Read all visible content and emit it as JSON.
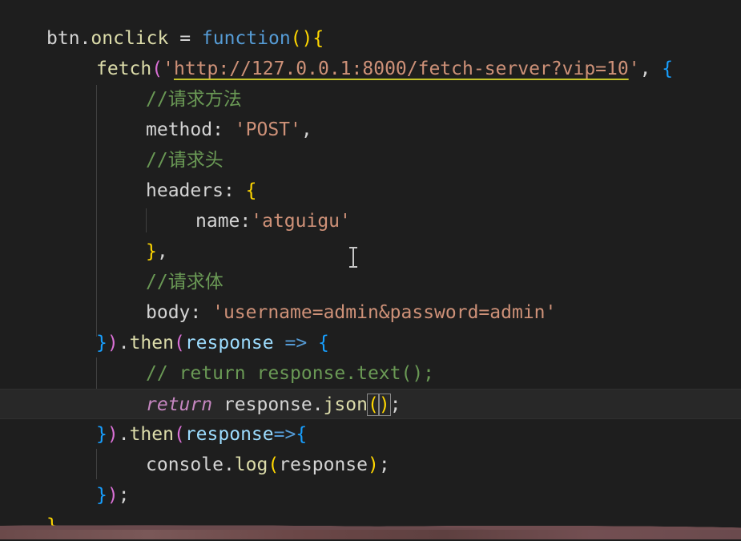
{
  "editor": {
    "lines": [
      {
        "tokens": [
          {
            "t": "btn",
            "c": "white"
          },
          {
            "t": ".",
            "c": "white"
          },
          {
            "t": "onclick",
            "c": "fn"
          },
          {
            "t": " = ",
            "c": "white"
          },
          {
            "t": "function",
            "c": "blue"
          },
          {
            "t": "(){",
            "c": "bracket-y"
          }
        ]
      },
      {
        "tokens": [
          {
            "t": "fetch",
            "c": "fn"
          },
          {
            "t": "(",
            "c": "bracket-p"
          },
          {
            "t": "'",
            "c": "str"
          },
          {
            "t": "http://127.0.0.1:8000/fetch-server?vip=10",
            "c": "url"
          },
          {
            "t": "'",
            "c": "str"
          },
          {
            "t": ", ",
            "c": "white"
          },
          {
            "t": "{",
            "c": "bracket-b"
          }
        ]
      },
      {
        "tokens": [
          {
            "t": "//请求方法",
            "c": "cmt"
          }
        ]
      },
      {
        "tokens": [
          {
            "t": "method",
            "c": "white"
          },
          {
            "t": ": ",
            "c": "white"
          },
          {
            "t": "'POST'",
            "c": "str"
          },
          {
            "t": ",",
            "c": "white"
          }
        ]
      },
      {
        "tokens": [
          {
            "t": "//请求头",
            "c": "cmt"
          }
        ]
      },
      {
        "tokens": [
          {
            "t": "headers",
            "c": "white"
          },
          {
            "t": ": ",
            "c": "white"
          },
          {
            "t": "{",
            "c": "bracket-y"
          }
        ]
      },
      {
        "tokens": [
          {
            "t": "name",
            "c": "white"
          },
          {
            "t": ":",
            "c": "white"
          },
          {
            "t": "'atguigu'",
            "c": "str"
          }
        ]
      },
      {
        "tokens": [
          {
            "t": "}",
            "c": "bracket-y"
          },
          {
            "t": ",",
            "c": "white"
          }
        ]
      },
      {
        "tokens": [
          {
            "t": "//请求体",
            "c": "cmt"
          }
        ]
      },
      {
        "tokens": [
          {
            "t": "body",
            "c": "white"
          },
          {
            "t": ": ",
            "c": "white"
          },
          {
            "t": "'username=admin&password=admin'",
            "c": "str"
          }
        ]
      },
      {
        "tokens": [
          {
            "t": "}",
            "c": "bracket-b"
          },
          {
            "t": ")",
            "c": "bracket-p"
          },
          {
            "t": ".",
            "c": "white"
          },
          {
            "t": "then",
            "c": "fn"
          },
          {
            "t": "(",
            "c": "bracket-p"
          },
          {
            "t": "response",
            "c": "param"
          },
          {
            "t": " ",
            "c": "white"
          },
          {
            "t": "=>",
            "c": "blue"
          },
          {
            "t": " ",
            "c": "white"
          },
          {
            "t": "{",
            "c": "bracket-b"
          }
        ]
      },
      {
        "tokens": [
          {
            "t": "// return response.text();",
            "c": "cmt"
          }
        ]
      },
      {
        "tokens": [
          {
            "t": "return",
            "c": "kw it"
          },
          {
            "t": " response",
            "c": "white"
          },
          {
            "t": ".",
            "c": "white"
          },
          {
            "t": "json",
            "c": "fn"
          },
          {
            "t": "(",
            "c": "bracket-y matchbox"
          },
          {
            "t": ")",
            "c": "bracket-y matchbox"
          },
          {
            "t": ";",
            "c": "white"
          }
        ]
      },
      {
        "tokens": [
          {
            "t": "}",
            "c": "bracket-b"
          },
          {
            "t": ")",
            "c": "bracket-p"
          },
          {
            "t": ".",
            "c": "white"
          },
          {
            "t": "then",
            "c": "fn"
          },
          {
            "t": "(",
            "c": "bracket-p"
          },
          {
            "t": "response",
            "c": "param"
          },
          {
            "t": "=>",
            "c": "blue"
          },
          {
            "t": "{",
            "c": "bracket-b"
          }
        ]
      },
      {
        "tokens": [
          {
            "t": "console",
            "c": "white"
          },
          {
            "t": ".",
            "c": "white"
          },
          {
            "t": "log",
            "c": "fn"
          },
          {
            "t": "(",
            "c": "bracket-y"
          },
          {
            "t": "response",
            "c": "white"
          },
          {
            "t": ")",
            "c": "bracket-y"
          },
          {
            "t": ";",
            "c": "white"
          }
        ]
      },
      {
        "tokens": [
          {
            "t": "}",
            "c": "bracket-b"
          },
          {
            "t": ")",
            "c": "bracket-p"
          },
          {
            "t": ";",
            "c": "white"
          }
        ]
      },
      {
        "tokens": [
          {
            "t": "}",
            "c": "bracket-y"
          }
        ]
      }
    ]
  }
}
